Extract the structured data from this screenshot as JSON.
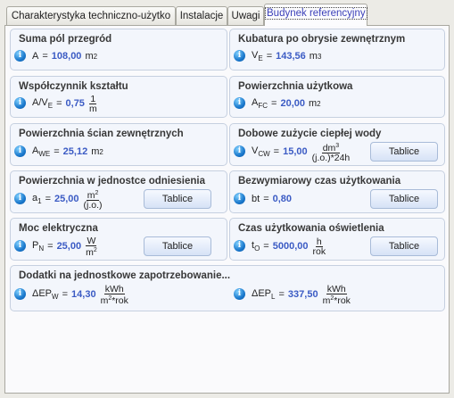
{
  "tabs": [
    "Charakterystyka techniczno-użytko",
    "Instalacje",
    "Uwagi",
    "Budynek referencyjny"
  ],
  "cards": {
    "suma_pol": {
      "title": "Suma pól przegród",
      "var": "A",
      "value": "108,00",
      "unit": "m",
      "unit_sup": "2"
    },
    "kubatura": {
      "title": "Kubatura po obrysie zewnętrznym",
      "var": "V",
      "var_sub": "E",
      "value": "143,56",
      "unit": "m",
      "unit_sup": "3"
    },
    "wspolczynnik": {
      "title": "Współczynnik kształtu",
      "var": "A/V",
      "var_sub": "E",
      "value": "0,75",
      "frac_num": "1",
      "frac_den": "m"
    },
    "pow_uzytkowa": {
      "title": "Powierzchnia użytkowa",
      "var": "A",
      "var_sub": "FC",
      "value": "20,00",
      "unit": "m",
      "unit_sup": "2"
    },
    "pow_scian": {
      "title": "Powierzchnia ścian zewnętrznych",
      "var": "A",
      "var_sub": "WE",
      "value": "25,12",
      "unit": "m",
      "unit_sup": "2"
    },
    "cwu": {
      "title": "Dobowe zużycie ciepłej wody",
      "var": "V",
      "var_sub": "CW",
      "value": "15,00",
      "frac_num": "dm",
      "frac_num_sup": "3",
      "frac_den": "(j.o.)*24h",
      "button": "Tablice"
    },
    "pow_jedn": {
      "title": "Powierzchnia w jednostce odniesienia",
      "var": "a",
      "var_sub": "1",
      "value": "25,00",
      "frac_num": "m",
      "frac_num_sup": "2",
      "frac_den": "(j.o.)",
      "button": "Tablice"
    },
    "bezwym": {
      "title": "Bezwymiarowy czas użytkowania",
      "var": "bt",
      "value": "0,80",
      "button": "Tablice"
    },
    "moc": {
      "title": "Moc elektryczna",
      "var": "P",
      "var_sub": "N",
      "value": "25,00",
      "frac_num": "W",
      "frac_den": "m",
      "frac_den_sup": "2",
      "button": "Tablice"
    },
    "czas_osw": {
      "title": "Czas użytkowania oświetlenia",
      "var": "t",
      "var_sub": "O",
      "value": "5000,00",
      "frac_num": "h",
      "frac_den": "rok",
      "button": "Tablice"
    },
    "dodatki": {
      "title": "Dodatki na jednostkowe zapotrzebowanie...",
      "w": {
        "var": "ΔEP",
        "var_sub": "W",
        "value": "14,30",
        "frac_num": "kWh",
        "frac_den": "m",
        "frac_den_sup": "2",
        "frac_den_tail": "*rok"
      },
      "l": {
        "var": "ΔEP",
        "var_sub": "L",
        "value": "337,50",
        "frac_num": "kWh",
        "frac_den": "m",
        "frac_den_sup": "2",
        "frac_den_tail": "*rok"
      }
    }
  },
  "eq": "=",
  "info_glyph": "i",
  "icons": {
    "info": "info-icon"
  },
  "colors": {
    "value": "#3b5bc4",
    "card_bg": "#f3f6fc",
    "active_tab_text": "#3a3fb8"
  }
}
